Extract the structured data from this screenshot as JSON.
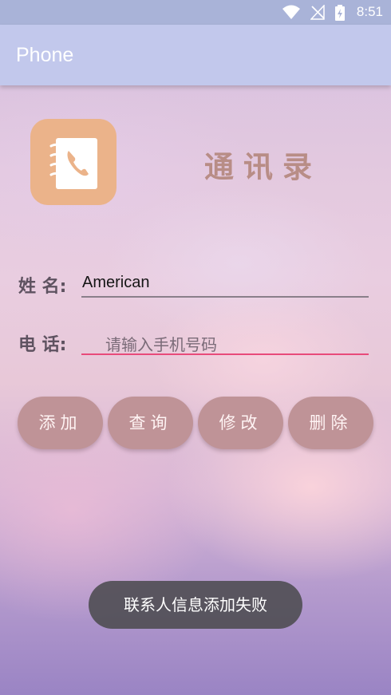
{
  "status_bar": {
    "time": "8:51",
    "icons": [
      "wifi-icon",
      "no-signal-icon",
      "battery-charging-icon"
    ]
  },
  "app_bar": {
    "title": "Phone"
  },
  "header": {
    "logo_icon": "phone-book-icon",
    "title": "通讯录"
  },
  "form": {
    "name_label": "姓 名:",
    "name_value": "American",
    "phone_label": "电 话:",
    "phone_placeholder": "请输入手机号码"
  },
  "buttons": {
    "add": "添加",
    "query": "查询",
    "modify": "修改",
    "delete": "删除"
  },
  "toast": {
    "message": "联系人信息添加失败"
  },
  "colors": {
    "app_bar": "#c2c8ec",
    "status_bar": "#a9b3d8",
    "button": "#bf9397",
    "focus_underline": "#e84a7a",
    "logo": "#ebb38a",
    "heading": "#b88d86"
  }
}
